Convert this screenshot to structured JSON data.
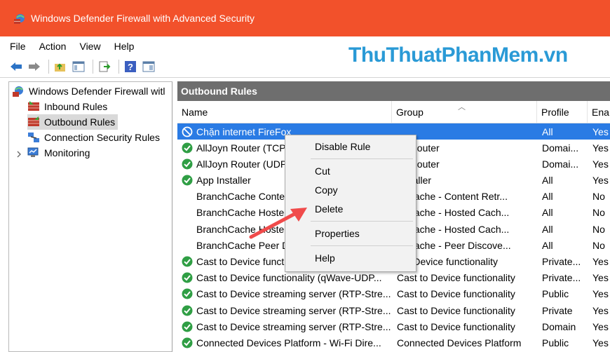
{
  "window": {
    "title": "Windows Defender Firewall with Advanced Security",
    "accent": "#f2512b"
  },
  "menubar": {
    "items": [
      "File",
      "Action",
      "View",
      "Help"
    ]
  },
  "watermark": "ThuThuatPhanMem.vn",
  "tree": {
    "root": "Windows Defender Firewall witl",
    "items": [
      "Inbound Rules",
      "Outbound Rules",
      "Connection Security Rules",
      "Monitoring"
    ]
  },
  "pane": {
    "title": "Outbound Rules",
    "columns": [
      "Name",
      "Group",
      "Profile",
      "Ena"
    ]
  },
  "rows": [
    {
      "name": "Chặn internet FireFox",
      "group": "",
      "profile": "All",
      "enabled": "Yes",
      "icon": "block-icon"
    },
    {
      "name": "AllJoyn Router (TCP",
      "group": "yn Router",
      "profile": "Domai...",
      "enabled": "Yes",
      "icon": "allow-icon"
    },
    {
      "name": "AllJoyn Router (UDP",
      "group": "yn Router",
      "profile": "Domai...",
      "enabled": "Yes",
      "icon": "allow-icon"
    },
    {
      "name": "App Installer",
      "group": "Installer",
      "profile": "All",
      "enabled": "Yes",
      "icon": "allow-icon"
    },
    {
      "name": "BranchCache Conte",
      "group": "chCache - Content Retr...",
      "profile": "All",
      "enabled": "No",
      "icon": "none"
    },
    {
      "name": "BranchCache Hoste",
      "group": "chCache - Hosted Cach...",
      "profile": "All",
      "enabled": "No",
      "icon": "none"
    },
    {
      "name": "BranchCache Hoste",
      "group": "chCache - Hosted Cach...",
      "profile": "All",
      "enabled": "No",
      "icon": "none"
    },
    {
      "name": "BranchCache Peer D",
      "group": "chCache - Peer Discove...",
      "profile": "All",
      "enabled": "No",
      "icon": "none"
    },
    {
      "name": "Cast to Device functi",
      "group": "t to Device functionality",
      "profile": "Private...",
      "enabled": "Yes",
      "icon": "allow-icon"
    },
    {
      "name": "Cast to Device functionality (qWave-UDP...",
      "group": "Cast to Device functionality",
      "profile": "Private...",
      "enabled": "Yes",
      "icon": "allow-icon"
    },
    {
      "name": "Cast to Device streaming server (RTP-Stre...",
      "group": "Cast to Device functionality",
      "profile": "Public",
      "enabled": "Yes",
      "icon": "allow-icon"
    },
    {
      "name": "Cast to Device streaming server (RTP-Stre...",
      "group": "Cast to Device functionality",
      "profile": "Private",
      "enabled": "Yes",
      "icon": "allow-icon"
    },
    {
      "name": "Cast to Device streaming server (RTP-Stre...",
      "group": "Cast to Device functionality",
      "profile": "Domain",
      "enabled": "Yes",
      "icon": "allow-icon"
    },
    {
      "name": "Connected Devices Platform - Wi-Fi Dire...",
      "group": "Connected Devices Platform",
      "profile": "Public",
      "enabled": "Yes",
      "icon": "allow-icon"
    }
  ],
  "context_menu": {
    "items": [
      "Disable Rule",
      "Cut",
      "Copy",
      "Delete",
      "Properties",
      "Help"
    ]
  }
}
